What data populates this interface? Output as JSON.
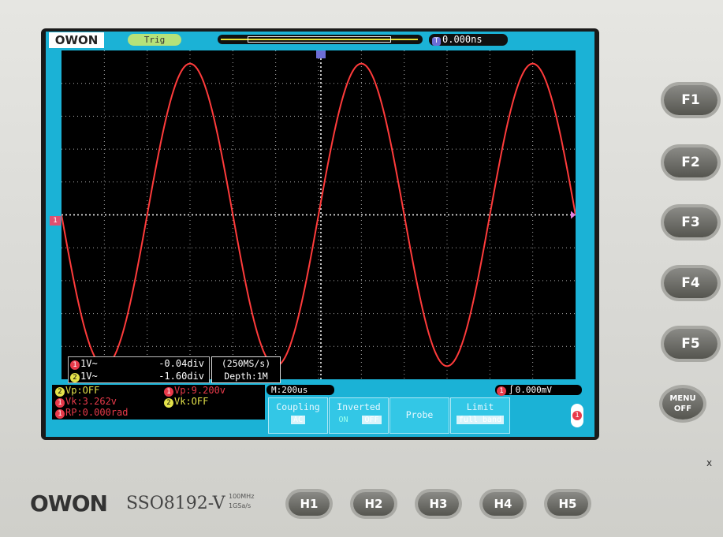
{
  "brand": {
    "logo": "OWON",
    "brand_label": "OWON",
    "model": "SSO8192-V",
    "spec_bandwidth": "100MHz",
    "spec_sample": "1GSa/s"
  },
  "top_bar": {
    "trigger_status": "Trig",
    "time_offset_icon": "T",
    "time_offset": "0.000ns"
  },
  "waveform": {
    "channel": "1",
    "color": "#ff3b3b",
    "cycles_visible": 3,
    "amplitude_div": 4.6,
    "phase_start": "descending-from-zero"
  },
  "channel_marker": "1",
  "channel_info": [
    {
      "ch": "1",
      "label": "1V~",
      "offset": "-0.04div"
    },
    {
      "ch": "2",
      "label": "1V~",
      "offset": "-1.60div"
    }
  ],
  "sample_info": {
    "rate": "(250MS/s)",
    "depth": "Depth:1M"
  },
  "measurements": {
    "ch2_vp": "Vp:OFF",
    "ch1_vp": "Vp:9.200v",
    "ch1_vk": "Vk:3.262v",
    "ch2_vk": "Vk:OFF",
    "ch1_rp": "RP:0.000rad"
  },
  "timebase": "M:200us",
  "trigger_level": "0.000mV",
  "softkeys": [
    {
      "label": "Coupling",
      "value": "AC"
    },
    {
      "label": "Inverted",
      "value": "ON",
      "value2": "OFF"
    },
    {
      "label": "Probe",
      "value": ""
    },
    {
      "label": "Limit",
      "value": "full band"
    }
  ],
  "side_channel": "1",
  "f_keys": [
    "F1",
    "F2",
    "F3",
    "F4",
    "F5"
  ],
  "menu_off": [
    "MENU",
    "OFF"
  ],
  "h_keys": [
    "H1",
    "H2",
    "H3",
    "H4",
    "H5"
  ],
  "stray_mark": "x",
  "colors": {
    "screen_bg": "#1bb2d6",
    "ch1": "#e83a4a",
    "ch2": "#e4e24a",
    "trace": "#ff3b3b"
  }
}
